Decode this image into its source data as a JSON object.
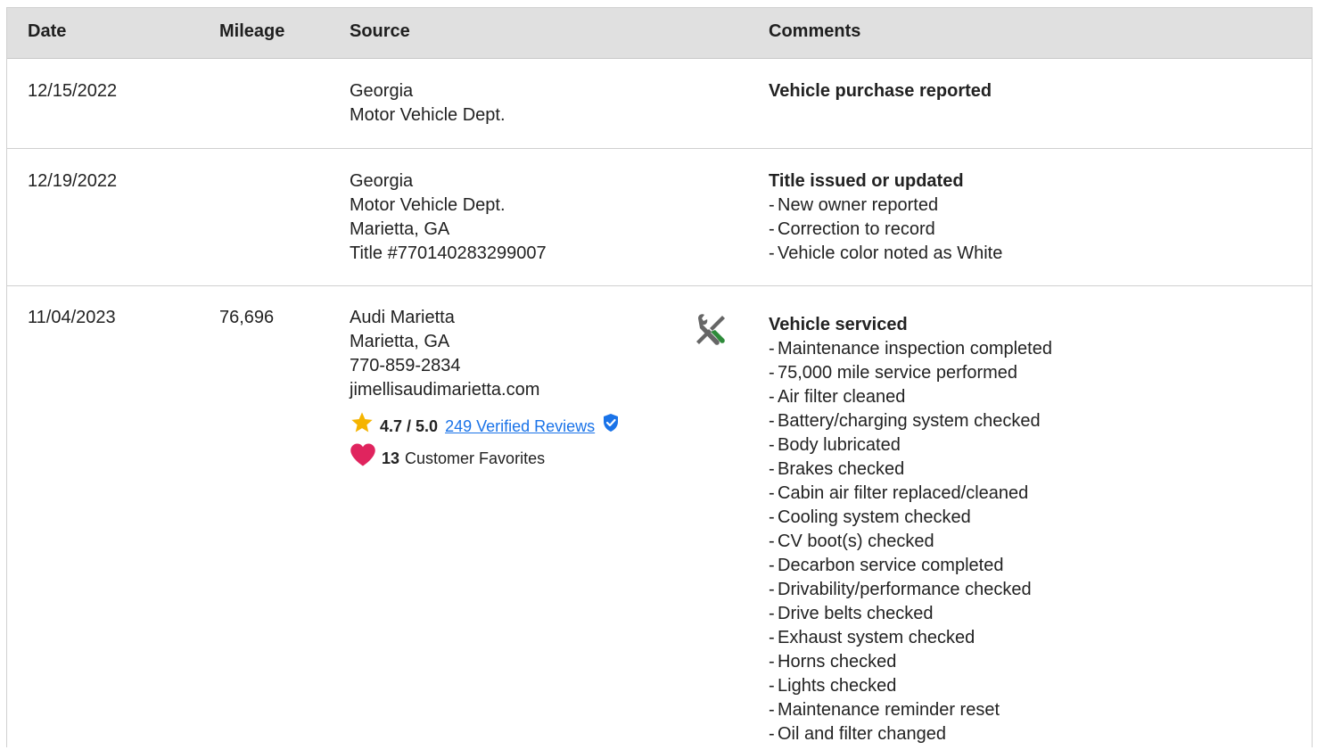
{
  "header": {
    "date": "Date",
    "mileage": "Mileage",
    "source": "Source",
    "comments": "Comments"
  },
  "rows": [
    {
      "date": "12/15/2022",
      "mileage": "",
      "source": [
        "Georgia",
        "Motor Vehicle Dept."
      ],
      "comment_title": "Vehicle purchase reported",
      "comment_items": []
    },
    {
      "date": "12/19/2022",
      "mileage": "",
      "source": [
        "Georgia",
        "Motor Vehicle Dept.",
        "Marietta, GA",
        "Title #770140283299007"
      ],
      "comment_title": "Title issued or updated",
      "comment_items": [
        "New owner reported",
        "Correction to record",
        "Vehicle color noted as White"
      ]
    },
    {
      "date": "11/04/2023",
      "mileage": "76,696",
      "source": [
        "Audi Marietta",
        "Marietta, GA",
        "770-859-2834",
        "jimellisaudimarietta.com"
      ],
      "rating": "4.7 / 5.0",
      "reviews_link": "249 Verified Reviews",
      "favorites_count": "13",
      "favorites_label": "Customer Favorites",
      "comment_title": "Vehicle serviced",
      "comment_items": [
        "Maintenance inspection completed",
        "75,000 mile service performed",
        "Air filter cleaned",
        "Battery/charging system checked",
        "Body lubricated",
        "Brakes checked",
        "Cabin air filter replaced/cleaned",
        "Cooling system checked",
        "CV boot(s) checked",
        "Decarbon service completed",
        "Drivability/performance checked",
        "Drive belts checked",
        "Exhaust system checked",
        "Horns checked",
        "Lights checked",
        "Maintenance reminder reset",
        "Oil and filter changed"
      ],
      "icons": {
        "service": "tools-icon",
        "rating": "star-icon",
        "verified": "shield-check-icon",
        "favorites": "heart-icon"
      }
    }
  ],
  "colors": {
    "header_bg": "#e0e0e0",
    "link": "#1a73e8",
    "star": "#f5b400",
    "heart": "#e0245e",
    "shield": "#1a73e8",
    "tool_green": "#2e8b3a",
    "tool_gray": "#666666"
  }
}
